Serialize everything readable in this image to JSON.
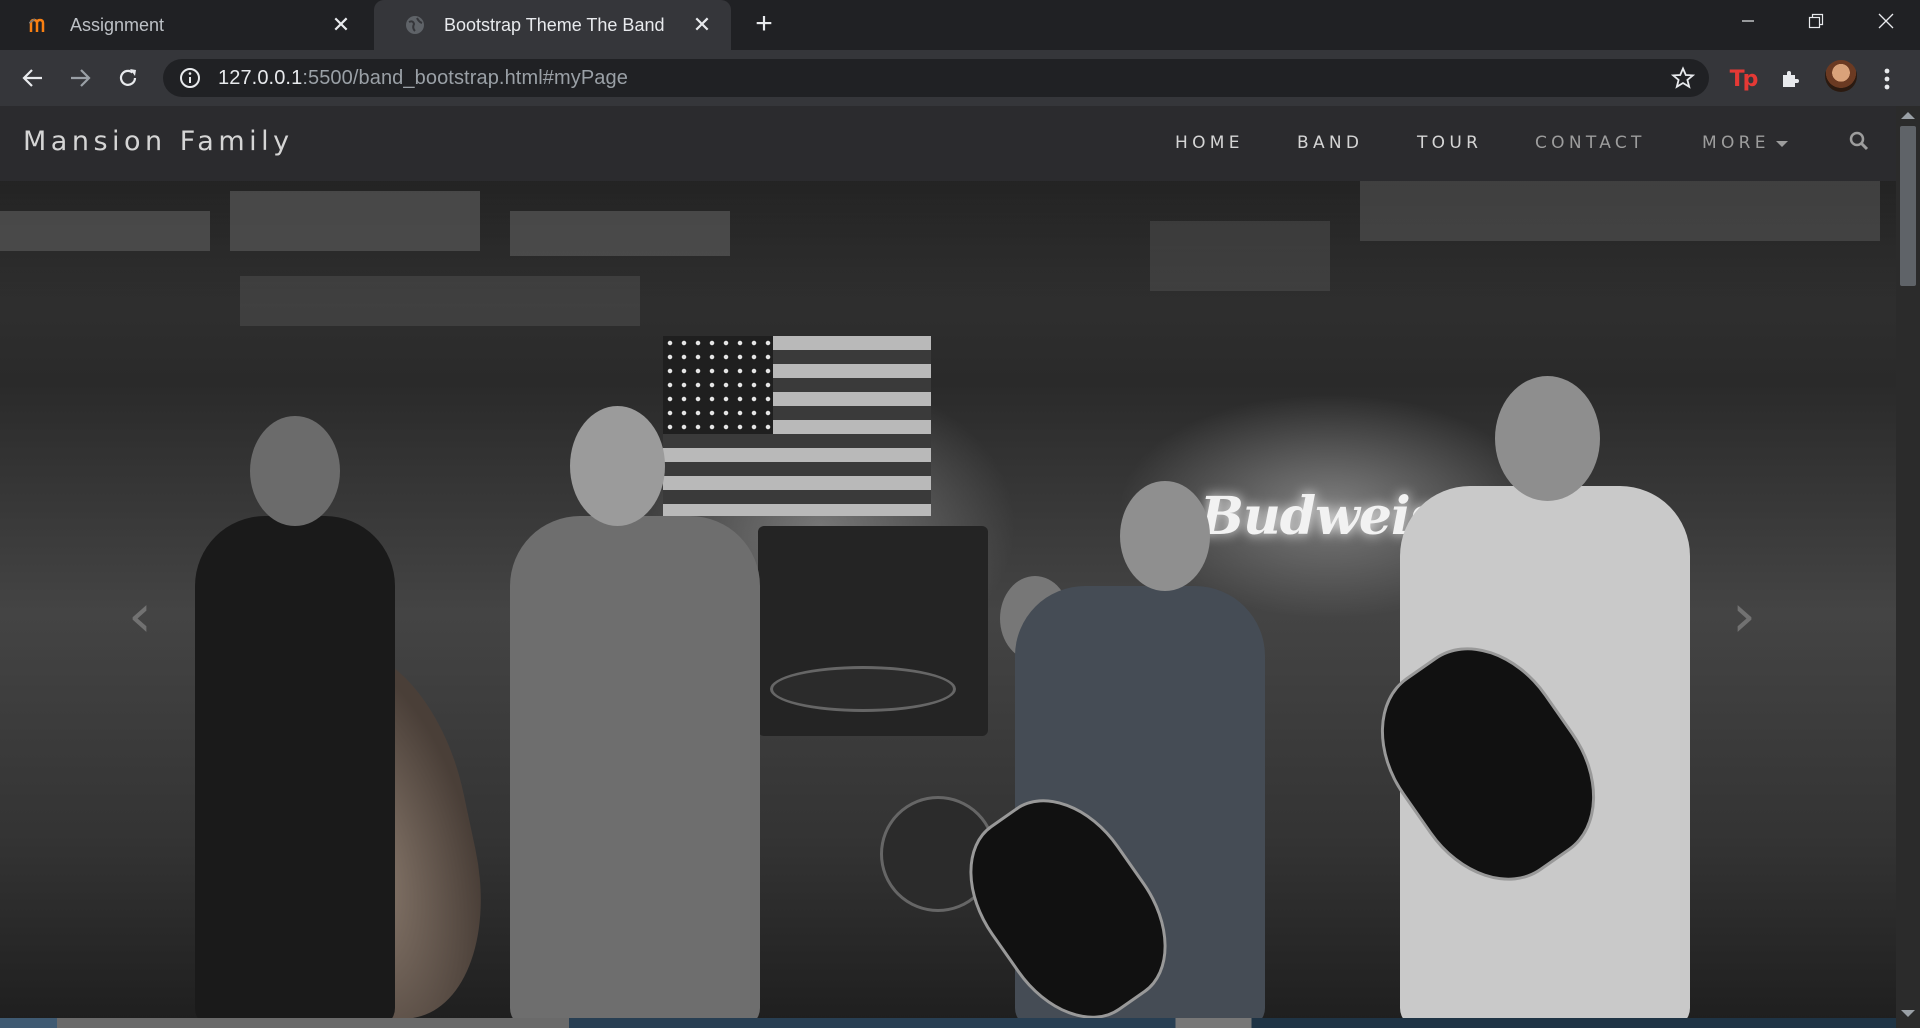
{
  "browser": {
    "tabs": [
      {
        "title": "Assignment",
        "active": false,
        "favicon": "moodle-favicon-icon"
      },
      {
        "title": "Bootstrap Theme The Band",
        "active": true,
        "favicon": "globe-favicon-icon"
      }
    ],
    "url": {
      "host": "127.0.0.1",
      "rest": ":5500/band_bootstrap.html#myPage"
    }
  },
  "site": {
    "brand": "Mansion Family",
    "nav": [
      {
        "label": "HOME"
      },
      {
        "label": "BAND"
      },
      {
        "label": "TOUR"
      },
      {
        "label": "CONTACT"
      },
      {
        "label": "MORE"
      }
    ],
    "carousel": {
      "prev_icon": "chevron-left-icon",
      "next_icon": "chevron-right-icon",
      "prev_glyph": "‹",
      "next_glyph": "›"
    },
    "hero_sign_text": "Budweiser"
  },
  "colors": {
    "chrome_dark": "#202124",
    "chrome_toolbar": "#35363a",
    "navbar": "#2d2d30",
    "nav_text": "#d5d5d5"
  }
}
